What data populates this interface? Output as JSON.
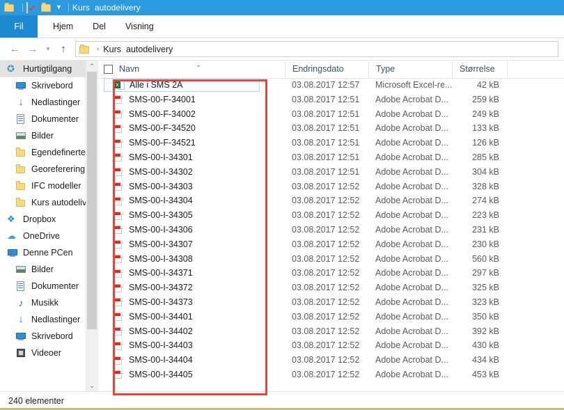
{
  "titlebar": {
    "title": "Kurs  autodelivery",
    "icons": [
      "folder-icon",
      "properties-icon",
      "new-folder-icon",
      "customize-quick-access-chevron-icon"
    ]
  },
  "ribbon": {
    "tabs": [
      {
        "label": "Fil",
        "active": true
      },
      {
        "label": "Hjem",
        "active": false
      },
      {
        "label": "Del",
        "active": false
      },
      {
        "label": "Visning",
        "active": false
      }
    ]
  },
  "addressbar": {
    "back": "←",
    "forward": "→",
    "recent": "▾",
    "up": "↑",
    "separator": "›",
    "path": "Kurs  autodelivery"
  },
  "sidebar": {
    "items": [
      {
        "label": "Hurtigtilgang",
        "icon": "star-pin-icon",
        "indent": 0,
        "selected": true,
        "pinned": false
      },
      {
        "label": "Skrivebord",
        "icon": "desktop-icon",
        "indent": 1,
        "selected": false,
        "pinned": true
      },
      {
        "label": "Nedlastinger",
        "icon": "downloads-icon",
        "indent": 1,
        "selected": false,
        "pinned": true
      },
      {
        "label": "Dokumenter",
        "icon": "documents-icon",
        "indent": 1,
        "selected": false,
        "pinned": true
      },
      {
        "label": "Bilder",
        "icon": "pictures-icon",
        "indent": 1,
        "selected": false,
        "pinned": true
      },
      {
        "label": "Egendefinerte O·",
        "icon": "folder-icon",
        "indent": 1,
        "selected": false,
        "pinned": false
      },
      {
        "label": "Georeferering",
        "icon": "folder-icon",
        "indent": 1,
        "selected": false,
        "pinned": false
      },
      {
        "label": "IFC modeller",
        "icon": "folder-icon",
        "indent": 1,
        "selected": false,
        "pinned": false
      },
      {
        "label": "Kurs  autodeliver",
        "icon": "folder-icon",
        "indent": 1,
        "selected": false,
        "pinned": false
      },
      {
        "label": "Dropbox",
        "icon": "dropbox-icon",
        "indent": 0,
        "selected": false,
        "pinned": false
      },
      {
        "label": "OneDrive",
        "icon": "onedrive-cloud-icon",
        "indent": 0,
        "selected": false,
        "pinned": false
      },
      {
        "label": "Denne PCen",
        "icon": "this-pc-icon",
        "indent": 0,
        "selected": false,
        "pinned": false
      },
      {
        "label": "Bilder",
        "icon": "pictures-icon",
        "indent": 1,
        "selected": false,
        "pinned": false
      },
      {
        "label": "Dokumenter",
        "icon": "documents-icon",
        "indent": 1,
        "selected": false,
        "pinned": false
      },
      {
        "label": "Musikk",
        "icon": "music-icon",
        "indent": 1,
        "selected": false,
        "pinned": false
      },
      {
        "label": "Nedlastinger",
        "icon": "downloads-icon",
        "indent": 1,
        "selected": false,
        "pinned": false
      },
      {
        "label": "Skrivebord",
        "icon": "desktop-icon",
        "indent": 1,
        "selected": false,
        "pinned": false
      },
      {
        "label": "Videoer",
        "icon": "videos-icon",
        "indent": 1,
        "selected": false,
        "pinned": false
      }
    ],
    "scroll_up": "⌃",
    "scroll_down": "⌄"
  },
  "filelist": {
    "columns": [
      {
        "key": "name",
        "label": "Navn",
        "sorted": "asc"
      },
      {
        "key": "date",
        "label": "Endringsdato"
      },
      {
        "key": "type",
        "label": "Type"
      },
      {
        "key": "size",
        "label": "Størrelse"
      }
    ],
    "sort_caret": "⌃",
    "rows": [
      {
        "name": "Alle i SMS 2A",
        "date": "03.08.2017 12:57",
        "type": "Microsoft Excel-re...",
        "size": "42 kB",
        "icon": "excel-file-icon",
        "selected": true
      },
      {
        "name": "SMS-00-F-34001",
        "date": "03.08.2017 12:51",
        "type": "Adobe Acrobat D...",
        "size": "259 kB",
        "icon": "pdf-file-icon",
        "selected": false
      },
      {
        "name": "SMS-00-F-34002",
        "date": "03.08.2017 12:51",
        "type": "Adobe Acrobat D...",
        "size": "249 kB",
        "icon": "pdf-file-icon",
        "selected": false
      },
      {
        "name": "SMS-00-F-34520",
        "date": "03.08.2017 12:51",
        "type": "Adobe Acrobat D...",
        "size": "133 kB",
        "icon": "pdf-file-icon",
        "selected": false
      },
      {
        "name": "SMS-00-F-34521",
        "date": "03.08.2017 12:51",
        "type": "Adobe Acrobat D...",
        "size": "126 kB",
        "icon": "pdf-file-icon",
        "selected": false
      },
      {
        "name": "SMS-00-I-34301",
        "date": "03.08.2017 12:51",
        "type": "Adobe Acrobat D...",
        "size": "285 kB",
        "icon": "pdf-file-icon",
        "selected": false
      },
      {
        "name": "SMS-00-I-34302",
        "date": "03.08.2017 12:51",
        "type": "Adobe Acrobat D...",
        "size": "304 kB",
        "icon": "pdf-file-icon",
        "selected": false
      },
      {
        "name": "SMS-00-I-34303",
        "date": "03.08.2017 12:52",
        "type": "Adobe Acrobat D...",
        "size": "328 kB",
        "icon": "pdf-file-icon",
        "selected": false
      },
      {
        "name": "SMS-00-I-34304",
        "date": "03.08.2017 12:52",
        "type": "Adobe Acrobat D...",
        "size": "274 kB",
        "icon": "pdf-file-icon",
        "selected": false
      },
      {
        "name": "SMS-00-I-34305",
        "date": "03.08.2017 12:52",
        "type": "Adobe Acrobat D...",
        "size": "223 kB",
        "icon": "pdf-file-icon",
        "selected": false
      },
      {
        "name": "SMS-00-I-34306",
        "date": "03.08.2017 12:52",
        "type": "Adobe Acrobat D...",
        "size": "231 kB",
        "icon": "pdf-file-icon",
        "selected": false
      },
      {
        "name": "SMS-00-I-34307",
        "date": "03.08.2017 12:52",
        "type": "Adobe Acrobat D...",
        "size": "230 kB",
        "icon": "pdf-file-icon",
        "selected": false
      },
      {
        "name": "SMS-00-I-34308",
        "date": "03.08.2017 12:52",
        "type": "Adobe Acrobat D...",
        "size": "560 kB",
        "icon": "pdf-file-icon",
        "selected": false
      },
      {
        "name": "SMS-00-I-34371",
        "date": "03.08.2017 12:52",
        "type": "Adobe Acrobat D...",
        "size": "297 kB",
        "icon": "pdf-file-icon",
        "selected": false
      },
      {
        "name": "SMS-00-I-34372",
        "date": "03.08.2017 12:52",
        "type": "Adobe Acrobat D...",
        "size": "325 kB",
        "icon": "pdf-file-icon",
        "selected": false
      },
      {
        "name": "SMS-00-I-34373",
        "date": "03.08.2017 12:52",
        "type": "Adobe Acrobat D...",
        "size": "323 kB",
        "icon": "pdf-file-icon",
        "selected": false
      },
      {
        "name": "SMS-00-I-34401",
        "date": "03.08.2017 12:52",
        "type": "Adobe Acrobat D...",
        "size": "350 kB",
        "icon": "pdf-file-icon",
        "selected": false
      },
      {
        "name": "SMS-00-I-34402",
        "date": "03.08.2017 12:52",
        "type": "Adobe Acrobat D...",
        "size": "392 kB",
        "icon": "pdf-file-icon",
        "selected": false
      },
      {
        "name": "SMS-00-I-34403",
        "date": "03.08.2017 12:52",
        "type": "Adobe Acrobat D...",
        "size": "430 kB",
        "icon": "pdf-file-icon",
        "selected": false
      },
      {
        "name": "SMS-00-I-34404",
        "date": "03.08.2017 12:52",
        "type": "Adobe Acrobat D...",
        "size": "434 kB",
        "icon": "pdf-file-icon",
        "selected": false
      },
      {
        "name": "SMS-00-I-34405",
        "date": "03.08.2017 12:52",
        "type": "Adobe Acrobat D...",
        "size": "453 kB",
        "icon": "pdf-file-icon",
        "selected": false
      }
    ]
  },
  "statusbar": {
    "item_count": "240 elementer"
  },
  "annotation": {
    "shape": "rectangle",
    "color": "#e8453c"
  },
  "colors": {
    "titlebar": "#2c9ade",
    "file_tab": "#1c8ad1",
    "selection_border": "#b4d5ea",
    "nav_selected": "#e3e3e3",
    "annotation_red": "#e8453c"
  }
}
